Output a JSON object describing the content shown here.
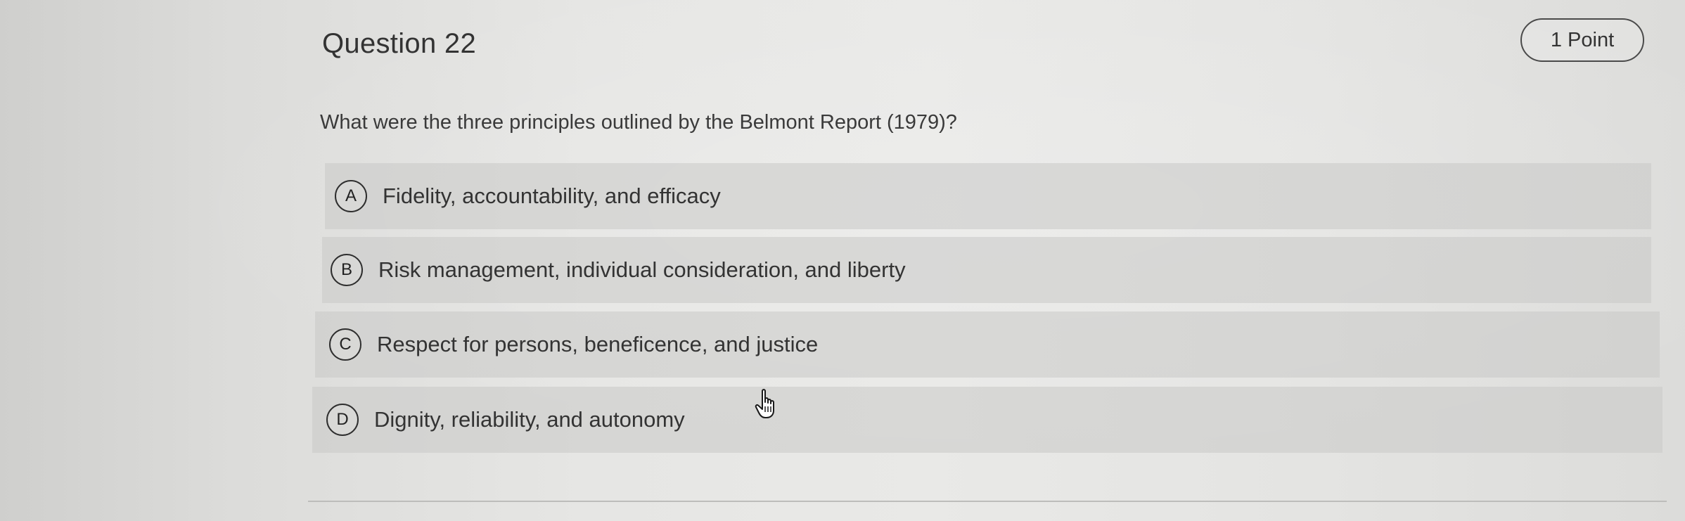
{
  "question": {
    "title": "Question 22",
    "points": "1 Point",
    "prompt": "What were the three principles outlined by the Belmont Report (1979)?"
  },
  "options": [
    {
      "letter": "A",
      "text": "Fidelity, accountability, and efficacy"
    },
    {
      "letter": "B",
      "text": "Risk management, individual consideration, and liberty"
    },
    {
      "letter": "C",
      "text": "Respect for persons, beneficence, and justice"
    },
    {
      "letter": "D",
      "text": "Dignity, reliability, and autonomy"
    }
  ],
  "cursor": {
    "icon": "hand-pointer-icon"
  }
}
